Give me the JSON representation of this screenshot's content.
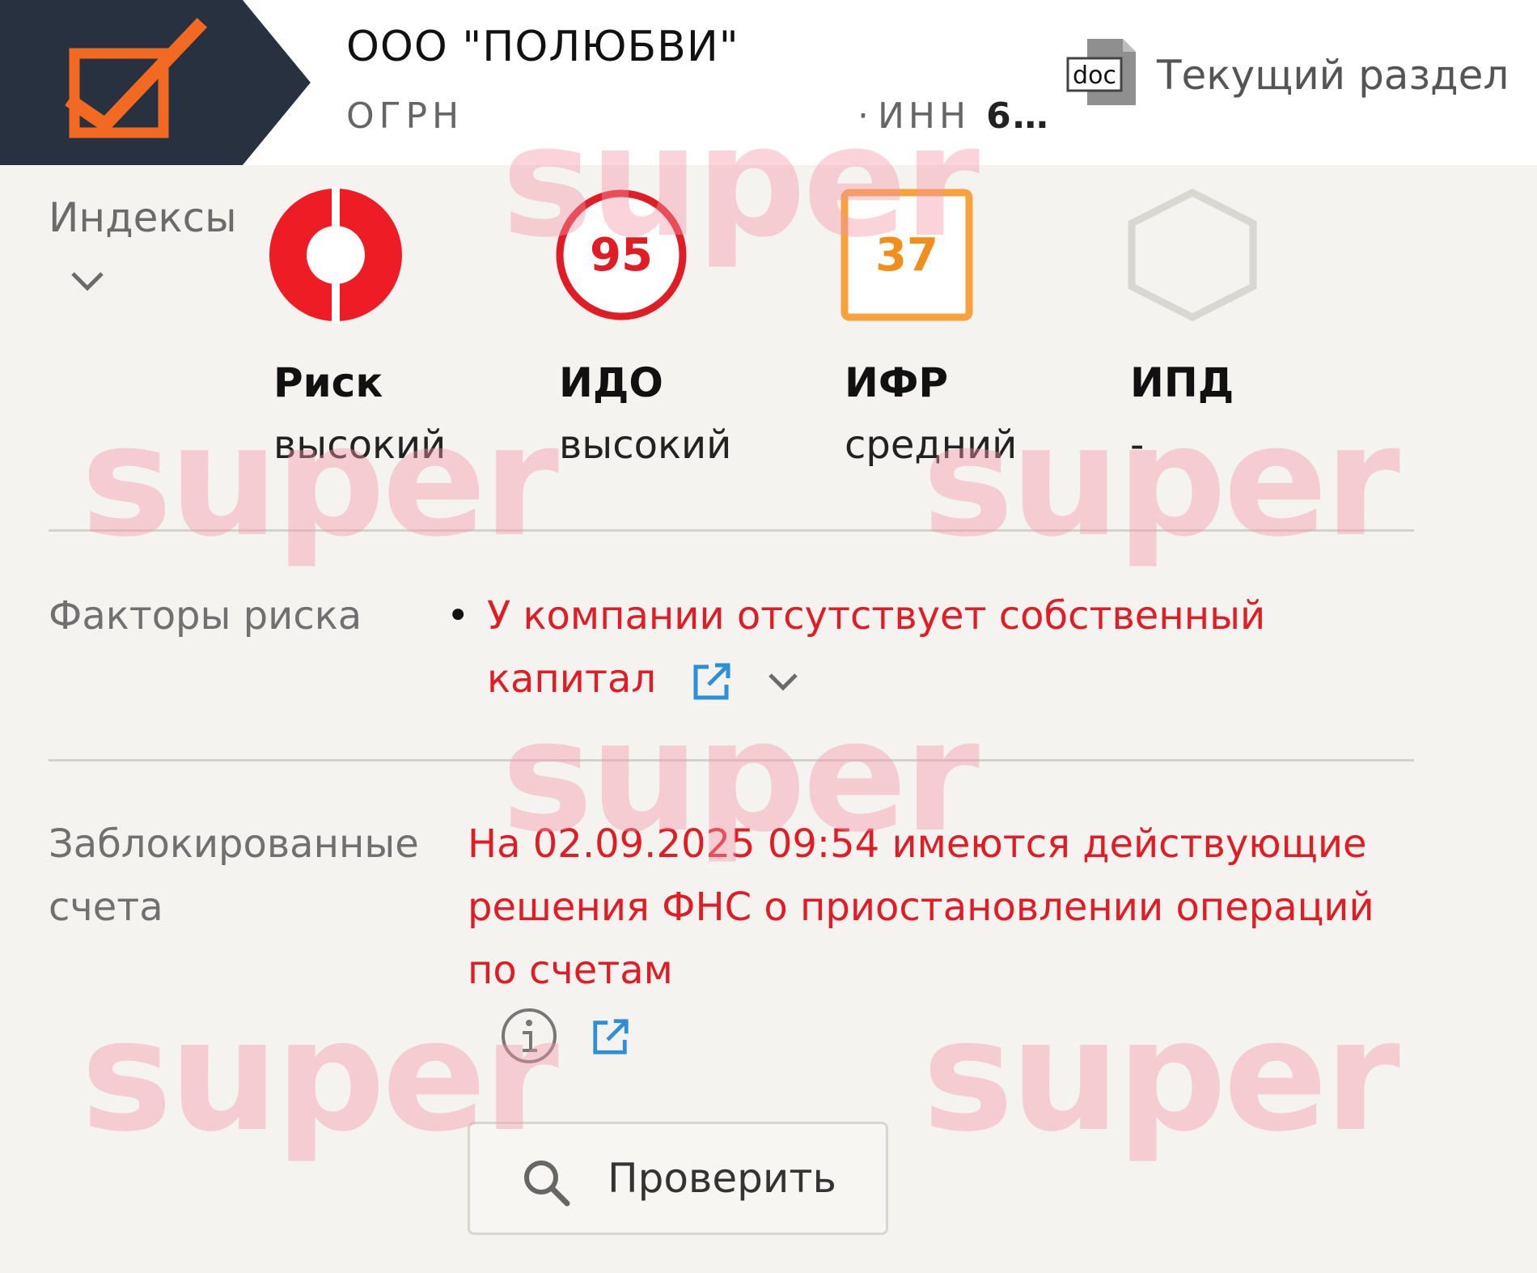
{
  "header": {
    "company_name": "ООО \"ПОЛЮБВИ\"",
    "ogrn_label": "ОГРН",
    "inn_label": "ИНН",
    "inn_value": "6…",
    "doc_icon_text": "doc",
    "current_section": "Текущий раздел"
  },
  "indices": {
    "label": "Индексы",
    "items": [
      {
        "name": "Риск",
        "level": "высокий",
        "badge": "",
        "color": "#ee1c24"
      },
      {
        "name": "ИДО",
        "level": "высокий",
        "badge": "95",
        "color": "#e01c24"
      },
      {
        "name": "ИФР",
        "level": "средний",
        "badge": "37",
        "color": "#f7a23c"
      },
      {
        "name": "ИПД",
        "level": "-",
        "badge": "",
        "color": "#d9d7d2"
      }
    ]
  },
  "risk_factors": {
    "label": "Факторы риска",
    "text": "У компании отсутствует собственный капитал"
  },
  "blocked_accounts": {
    "label_line1": "Заблокированные",
    "label_line2": "счета",
    "text": "На 02.09.2025 09:54 имеются действующие решения ФНС о приостановлении операций по счетам"
  },
  "check_button": {
    "label": "Проверить"
  },
  "watermark": {
    "text": "super"
  },
  "colors": {
    "logo_bg": "#27313f",
    "accent_orange": "#f26a21",
    "danger": "#e01c24",
    "link_blue": "#2d8fd8"
  }
}
